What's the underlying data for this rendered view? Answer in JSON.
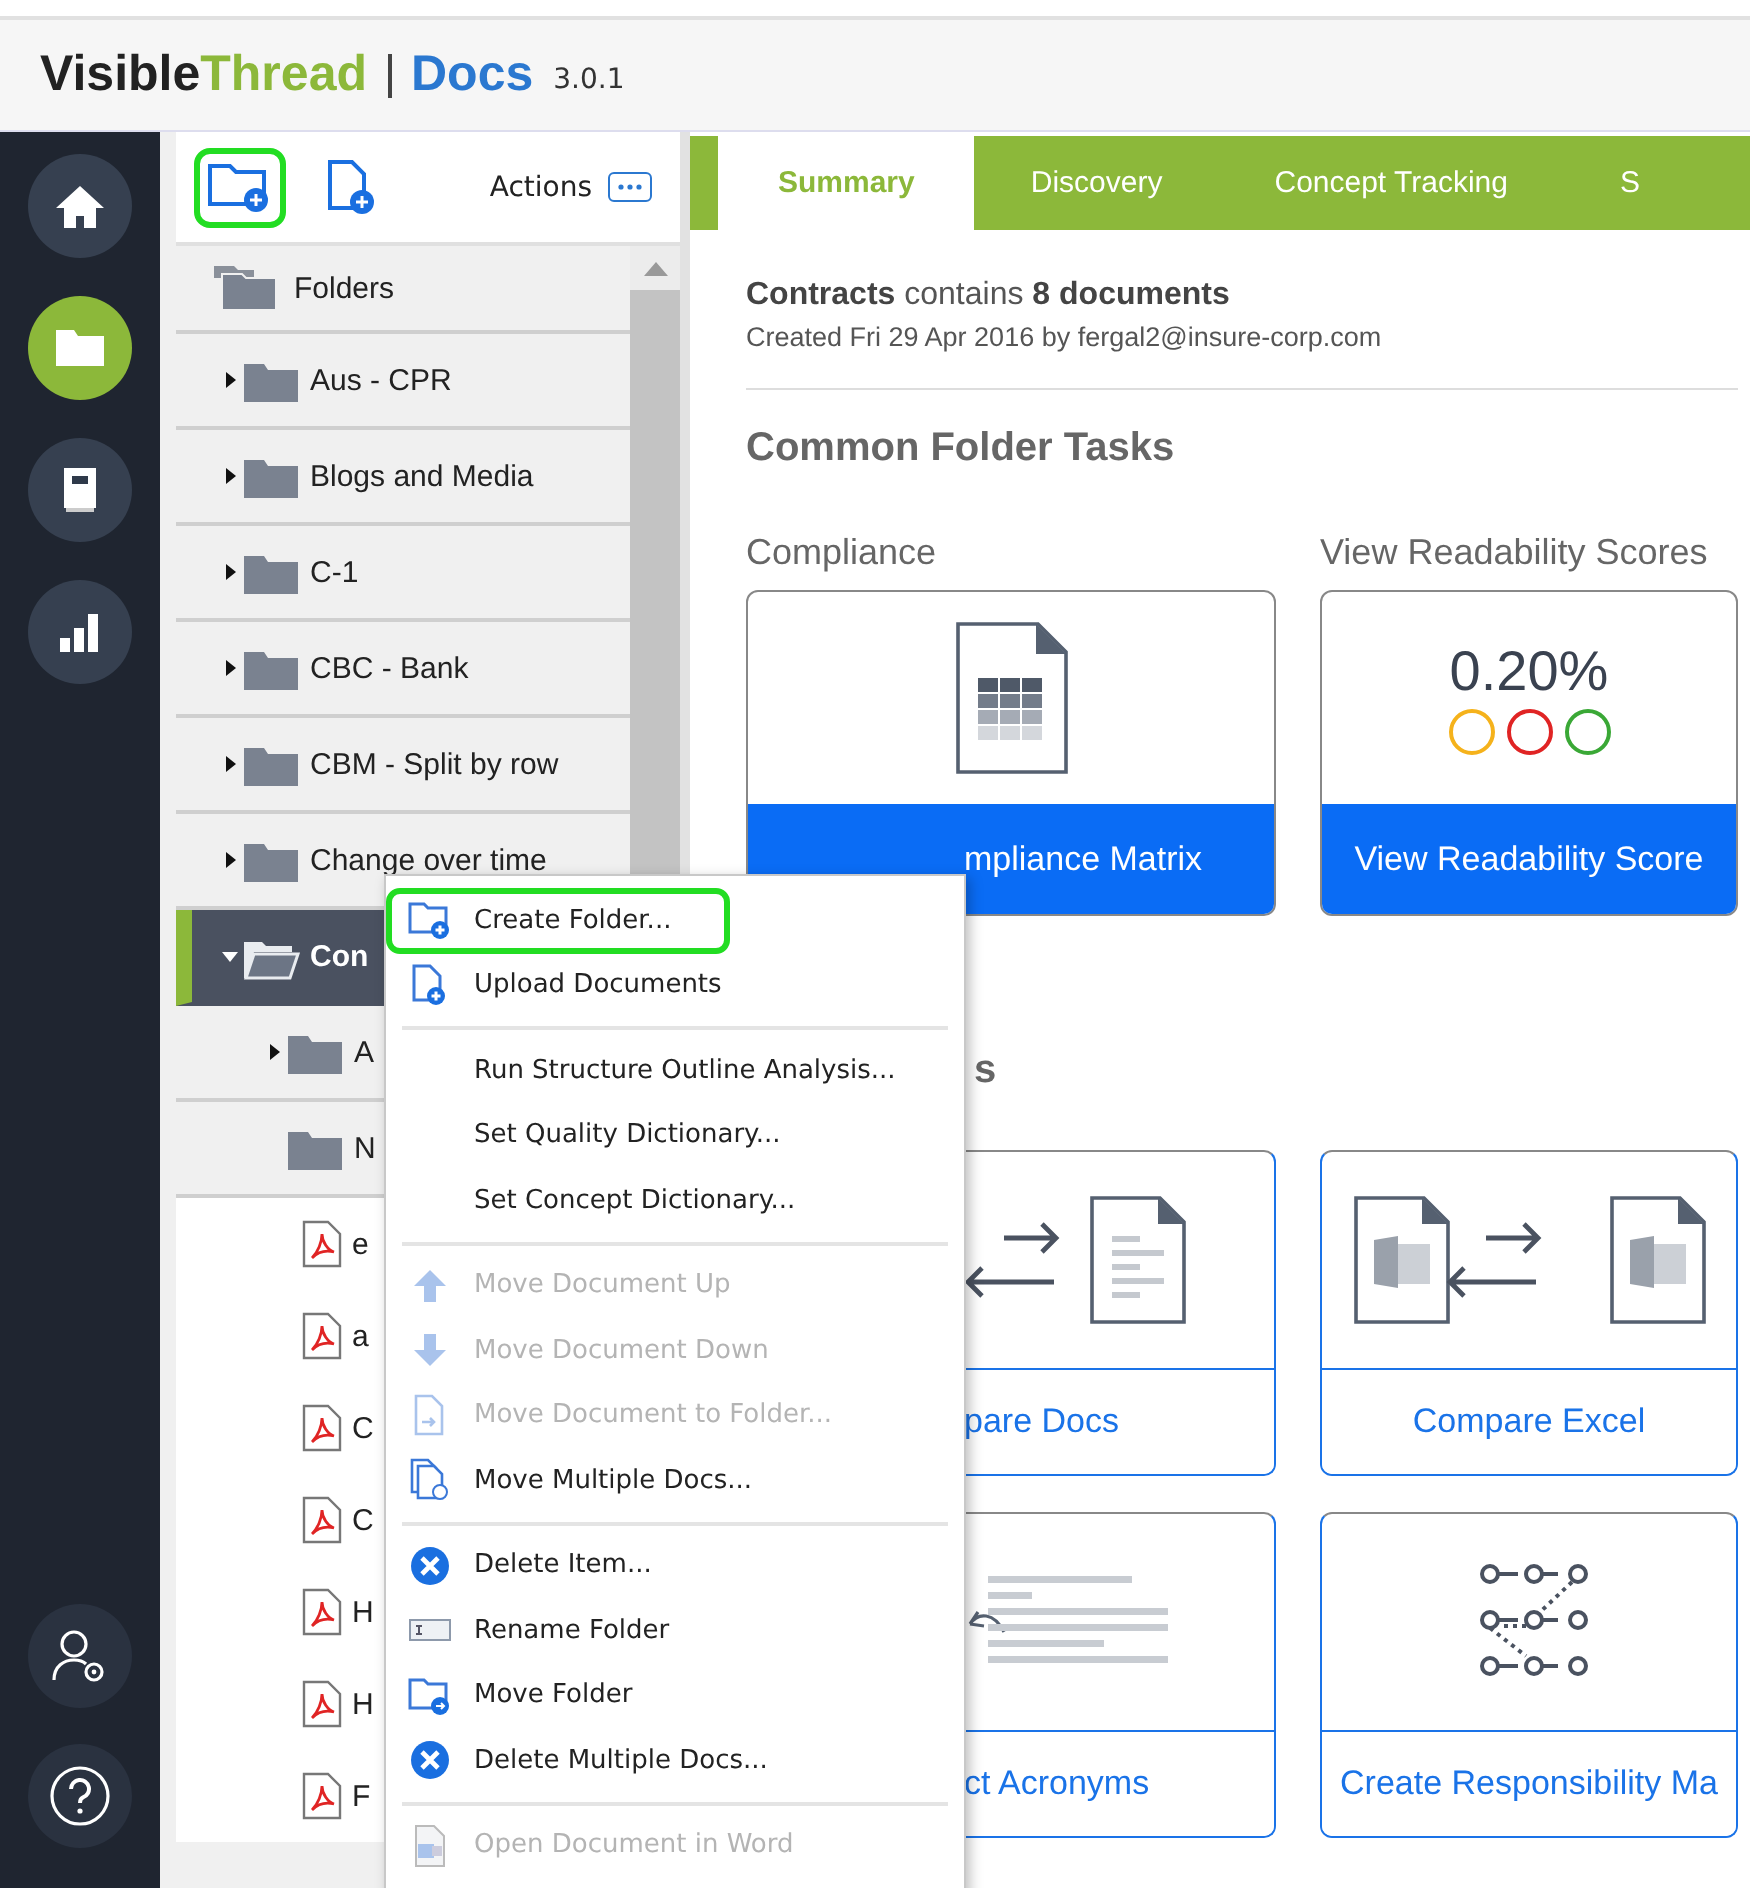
{
  "header": {
    "brand_dark": "Visible",
    "brand_green": "Thread",
    "product": "Docs",
    "version": "3.0.1"
  },
  "nav": [
    {
      "selected": false
    },
    {
      "selected": true
    },
    {
      "selected": false
    },
    {
      "selected": false
    }
  ],
  "toolbar": {
    "buttons": [
      {
        "highlighted": true
      },
      {
        "highlighted": false
      }
    ],
    "actions_label": "Actions"
  },
  "tree": {
    "root": "Folders",
    "items": [
      {
        "kind": "folder",
        "label": "Aus - CPR",
        "expanded": false,
        "selected": false
      },
      {
        "kind": "folder",
        "label": "Blogs and Media",
        "expanded": false,
        "selected": false
      },
      {
        "kind": "folder",
        "label": "C-1",
        "expanded": false,
        "selected": false
      },
      {
        "kind": "folder",
        "label": "CBC - Bank",
        "expanded": false,
        "selected": false
      },
      {
        "kind": "folder",
        "label": "CBM - Split by row",
        "expanded": false,
        "selected": false
      },
      {
        "kind": "folder",
        "label": "Change over time",
        "expanded": false,
        "selected": false
      },
      {
        "kind": "folder",
        "label": "Con",
        "expanded": true,
        "selected": true,
        "children": [
          {
            "kind": "folder",
            "label": "A",
            "expanded": false,
            "selected": false
          },
          {
            "kind": "leaf-folder",
            "label": "N",
            "selected": false
          },
          {
            "kind": "pdf",
            "label": "e",
            "selected": false
          },
          {
            "kind": "pdf",
            "label": "a",
            "selected": false
          },
          {
            "kind": "pdf",
            "label": "C",
            "selected": false
          },
          {
            "kind": "pdf",
            "label": "C",
            "selected": false
          },
          {
            "kind": "pdf",
            "label": "H",
            "selected": false
          },
          {
            "kind": "pdf",
            "label": "H",
            "selected": false
          },
          {
            "kind": "pdf",
            "label": "F",
            "selected": false
          }
        ]
      }
    ]
  },
  "context_menu": [
    {
      "kind": "item",
      "label": "Create Folder...",
      "disabled": false,
      "highlighted": true
    },
    {
      "kind": "item",
      "label": "Upload Documents",
      "disabled": false,
      "highlighted": false
    },
    {
      "kind": "separator"
    },
    {
      "kind": "item",
      "label": "Run Structure Outline Analysis...",
      "disabled": false,
      "highlighted": false
    },
    {
      "kind": "item",
      "label": "Set Quality Dictionary...",
      "disabled": false,
      "highlighted": false
    },
    {
      "kind": "item",
      "label": "Set Concept Dictionary...",
      "disabled": false,
      "highlighted": false
    },
    {
      "kind": "separator"
    },
    {
      "kind": "item",
      "label": "Move Document Up",
      "disabled": true,
      "highlighted": false
    },
    {
      "kind": "item",
      "label": "Move Document Down",
      "disabled": true,
      "highlighted": false
    },
    {
      "kind": "item",
      "label": "Move Document to Folder...",
      "disabled": true,
      "highlighted": false
    },
    {
      "kind": "item",
      "label": "Move Multiple Docs...",
      "disabled": false,
      "highlighted": false
    },
    {
      "kind": "separator"
    },
    {
      "kind": "item",
      "label": "Delete Item...",
      "disabled": false,
      "highlighted": false
    },
    {
      "kind": "item",
      "label": "Rename Folder",
      "disabled": false,
      "highlighted": false
    },
    {
      "kind": "item",
      "label": "Move Folder",
      "disabled": false,
      "highlighted": false
    },
    {
      "kind": "item",
      "label": "Delete Multiple Docs...",
      "disabled": false,
      "highlighted": false
    },
    {
      "kind": "separator"
    },
    {
      "kind": "item",
      "label": "Open Document in Word",
      "disabled": true,
      "highlighted": false
    }
  ],
  "tabs": [
    {
      "label": "Summary",
      "selected": true
    },
    {
      "label": "Discovery",
      "selected": false
    },
    {
      "label": "Concept Tracking",
      "selected": false
    },
    {
      "label": "S",
      "selected": false
    }
  ],
  "summary": {
    "headline": "**Contracts** contains **8 documents**",
    "created": "Created Fri 29 Apr 2016 by fergal2@insure-corp.com"
  },
  "sections": [
    {
      "heading": "Common Folder Tasks",
      "rows": [
        {
          "titles": [
            "Compliance",
            "View Readability Scores"
          ],
          "cards": [
            {
              "kind": "compliance",
              "label": "mpliance Matrix"
            },
            {
              "kind": "readability",
              "score": "0.20%",
              "dots": [
                {
                  "color": "#f5b21b"
                },
                {
                  "color": "#e02424"
                },
                {
                  "color": "#3aa836"
                }
              ],
              "label": "View Readability Score"
            }
          ]
        }
      ]
    },
    {
      "heading": "s",
      "rows": [
        {
          "cards": [
            {
              "kind": "compare-docs",
              "label": "pare Docs"
            },
            {
              "kind": "compare-excel",
              "label": "Compare Excel"
            }
          ]
        },
        {
          "cards": [
            {
              "kind": "acronyms",
              "label": "ct Acronyms"
            },
            {
              "kind": "responsibility",
              "label": "Create Responsibility Ma"
            }
          ]
        }
      ]
    }
  ]
}
